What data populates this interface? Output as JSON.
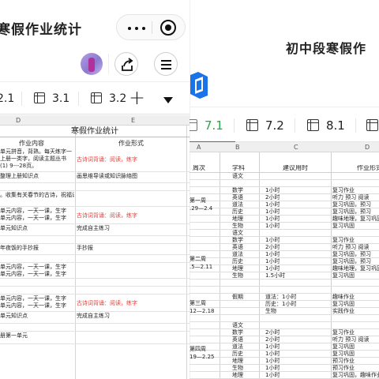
{
  "left_screen": {
    "title": "寒假作业统计",
    "tabs": [
      "2.1",
      "3.1",
      "3.2"
    ],
    "col_headers": [
      "D",
      "E"
    ],
    "sheet_title": "寒假作业统计",
    "col_labels": {
      "content": "作业内容",
      "form": "作业形式"
    },
    "rows": [
      {
        "content": "单元拼音，背熟。每天练字一\n上册一类字，阅读主题丛书\n(1) 9---28页。",
        "form": "古诗词背诵：阅读，练字",
        "form_red": true
      },
      {
        "content": "整理上册知识点",
        "form": "画思维导读或知识脉络图",
        "form_red": false
      },
      {
        "content": "",
        "form": "",
        "form_red": false
      },
      {
        "content": "。收集有关春节的古诗，祝福语写在练习本上",
        "form": "",
        "form_red": false
      },
      {
        "content": "单元内容，一天一课，生字\n单元内容，一天一课，生字",
        "form": "古诗词背诵：阅读，练字",
        "form_red": true
      },
      {
        "content": "单元知识点",
        "form": "完成自主练习",
        "form_red": false
      },
      {
        "content": "",
        "form": "",
        "form_red": false
      },
      {
        "content": "年夜饭的手抄报",
        "form": "手抄报",
        "form_red": false
      },
      {
        "content": "",
        "form": "",
        "form_red": false
      },
      {
        "content": "单元内容，一天一课，生字\n单元内容，一天一课，生字",
        "form": "",
        "form_red": false
      },
      {
        "content": "",
        "form": "",
        "form_red": false
      },
      {
        "content": "",
        "form": "",
        "form_red": false
      },
      {
        "content": "单元内容，一天一课，生字\n单元内容，一天一课，生字",
        "form": "古诗词背诵：阅读，练字",
        "form_red": true
      },
      {
        "content": "单元知识点",
        "form": "完成自主练习",
        "form_red": false
      },
      {
        "content": "",
        "form": "",
        "form_red": false
      },
      {
        "content": "册第一单元",
        "form": "",
        "form_red": false
      }
    ]
  },
  "right_screen": {
    "title": "初中段寒假作",
    "tabs": [
      "7.1",
      "7.2",
      "8.1"
    ],
    "active_tab": "7.1",
    "col_headers": [
      "A",
      "B",
      "C",
      "D"
    ],
    "header_row": [
      "周次",
      "学科",
      "建议用时",
      "作业形式"
    ],
    "weeks": [
      "第一周\n.29—2.4",
      "第二周\n.5—2.11",
      "第三周\n12—2.18",
      "第四周\n19—2.25"
    ],
    "rows": [
      [
        "",
        "语文",
        "",
        ""
      ],
      [
        "",
        "",
        "",
        ""
      ],
      [
        "",
        "数学",
        "1小时",
        "复习作业"
      ],
      [
        "",
        "英语",
        "2小时",
        "听力 预习 阅读"
      ],
      [
        "",
        "道法",
        "1小时",
        "复习巩固，预习"
      ],
      [
        "",
        "历史",
        "1小时",
        "复习巩固，预习"
      ],
      [
        "",
        "地理",
        "1小时",
        "趣味地理，复习巩固"
      ],
      [
        "",
        "生物",
        "1小时",
        "复习巩固"
      ],
      [
        "",
        "语文",
        "",
        ""
      ],
      [
        "",
        "数学",
        "1小时",
        "复习作业"
      ],
      [
        "",
        "英语",
        "2小时",
        "听力 预习 阅读"
      ],
      [
        "",
        "道法",
        "1小时",
        "复习巩固，预习"
      ],
      [
        "",
        "历史",
        "1小时",
        "复习巩固，预习"
      ],
      [
        "",
        "地理",
        "1小时",
        "趣味地理，复习巩固"
      ],
      [
        "",
        "生物",
        "1.5小时",
        "复习巩固"
      ],
      [
        "",
        "",
        "",
        ""
      ],
      [
        "",
        "",
        "",
        ""
      ],
      [
        "",
        "假期",
        "道法：1小时",
        "趣味作业"
      ],
      [
        "",
        "",
        "历史：1小时",
        "复习巩固"
      ],
      [
        "",
        "",
        "生物",
        "实践作业"
      ],
      [
        "",
        "",
        "",
        ""
      ],
      [
        "",
        "语文",
        "",
        ""
      ],
      [
        "",
        "数学",
        "2小时",
        "复习作业"
      ],
      [
        "",
        "英语",
        "2小时",
        "听力 预习 阅读"
      ],
      [
        "",
        "道法",
        "1小时",
        "复习巩固"
      ],
      [
        "",
        "历史",
        "1小时",
        "复习巩固"
      ],
      [
        "",
        "地理",
        "1小时",
        "预习作业"
      ],
      [
        "",
        "生物",
        "1小时",
        "预习作业"
      ],
      [
        "",
        "地理",
        "1小时",
        "复习巩固，趣味作业"
      ],
      [
        "",
        "生物",
        "1小时",
        "预习作业"
      ]
    ]
  },
  "colors": {
    "accent_green": "#28a745",
    "red_text": "#e0433c"
  },
  "icons": [
    "more-dots-icon",
    "target-icon",
    "avatar",
    "share-icon",
    "menu-icon",
    "grid-icon",
    "plus-icon",
    "caret-down-icon",
    "app-logo-icon"
  ]
}
